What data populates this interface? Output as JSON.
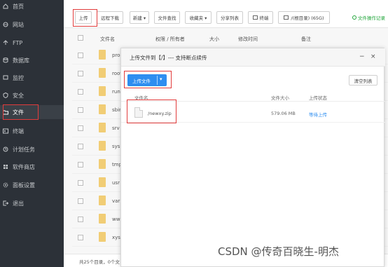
{
  "sidebar": {
    "items": [
      {
        "label": "首页",
        "icon": "home-icon"
      },
      {
        "label": "网站",
        "icon": "globe-icon"
      },
      {
        "label": "FTP",
        "icon": "ftp-icon"
      },
      {
        "label": "数据库",
        "icon": "database-icon"
      },
      {
        "label": "监控",
        "icon": "monitor-icon"
      },
      {
        "label": "安全",
        "icon": "shield-icon"
      },
      {
        "label": "文件",
        "icon": "folder-icon",
        "active": true
      },
      {
        "label": "终端",
        "icon": "terminal-icon"
      },
      {
        "label": "计划任务",
        "icon": "clock-icon"
      },
      {
        "label": "软件商店",
        "icon": "store-icon"
      },
      {
        "label": "面板设置",
        "icon": "gear-icon"
      },
      {
        "label": "退出",
        "icon": "logout-icon"
      }
    ]
  },
  "toolbar": {
    "upload": "上传",
    "remote_download": "远程下载",
    "new": "新建 ▾",
    "file_search": "文件查找",
    "favorites": "收藏夹 ▾",
    "share_list": "分享列表",
    "terminal": "终端",
    "root_dir": "/(根目录) (65G)",
    "op_log": "文件操作记录"
  },
  "table": {
    "headers": {
      "name": "文件名",
      "perm": "权限 / 所有者",
      "size": "大小",
      "mtime": "修改时间",
      "note": "备注"
    },
    "rows": [
      "proc",
      "root",
      "run",
      "sbin",
      "srv",
      "sys",
      "tmp",
      "usr",
      "var",
      "www",
      "xysq"
    ]
  },
  "footer": {
    "summary": "共25个目录，0个文"
  },
  "dialog": {
    "title": "上传文件到【/】--- 支持断点续传",
    "minimize": "−",
    "close": "×",
    "upload_button": "上传文件",
    "upload_caret": "▾",
    "clear_button": "清空列表",
    "headers": {
      "name": "文件名",
      "size": "文件大小",
      "status": "上传状态"
    },
    "files": [
      {
        "name": "/newxy.zip",
        "size": "579.06 MB",
        "status": "等待上传"
      }
    ]
  },
  "watermark": "CSDN @传奇百晓生-明杰",
  "colors": {
    "sidebar_bg": "#2c3138",
    "primary": "#2e8ef0",
    "highlight": "#e23c3c",
    "folder": "#f1cd75"
  }
}
